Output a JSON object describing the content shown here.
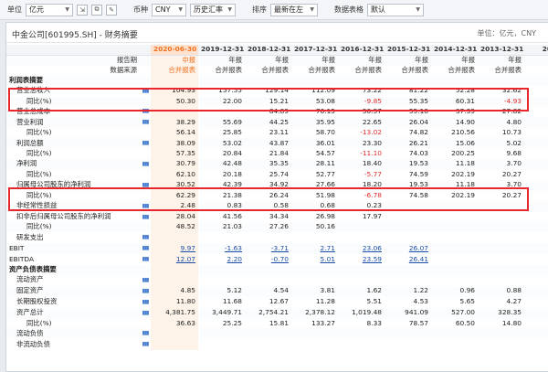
{
  "toolbar": {
    "unit_label": "单位",
    "unit_value": "亿元",
    "currency_label": "币种",
    "currency_value": "CNY",
    "rate_value": "历史汇率",
    "sort_label": "排序",
    "sort_value": "最新在左",
    "table_label": "数据表格",
    "table_value": "默认"
  },
  "header": {
    "company": "中金公司[601995.SH] - 财务摘要",
    "unit_note": "单位：亿元，CNY"
  },
  "table": {
    "dates": [
      "2020-06-30",
      "2019-12-31",
      "2018-12-31",
      "2017-12-31",
      "2016-12-31",
      "2015-12-31",
      "2014-12-31",
      "2013-12-31",
      "20"
    ],
    "period_label": "报告期",
    "periods": [
      "中报",
      "年报",
      "年报",
      "年报",
      "年报",
      "年报",
      "年报",
      "年报"
    ],
    "source_label": "数据来源",
    "sources": [
      "合并报表",
      "合并报表",
      "合并报表",
      "合并报表",
      "合并报表",
      "合并报表",
      "合并报表",
      "合并报表"
    ],
    "rows": [
      {
        "label": "利润表摘要",
        "type": "sec",
        "values": []
      },
      {
        "label": "营业总收入",
        "type": "l1",
        "chart": true,
        "values": [
          "104.93",
          "157.55",
          "129.14",
          "112.09",
          "73.22",
          "81.22",
          "52.28",
          "32.62"
        ]
      },
      {
        "label": "同比(%)",
        "type": "l2",
        "values": [
          "50.30",
          "22.00",
          "15.21",
          "53.08",
          "-9.85",
          "55.35",
          "60.31",
          "-4.93"
        ]
      },
      {
        "label": "营业总成本",
        "type": "l1",
        "chart": true,
        "values": [
          "",
          "",
          "84.89",
          "76.15",
          "50.57",
          "55.18",
          "37.39",
          "27.82"
        ]
      },
      {
        "label": "营业利润",
        "type": "l1",
        "chart": true,
        "values": [
          "38.29",
          "55.69",
          "44.25",
          "35.95",
          "22.65",
          "26.04",
          "14.90",
          "4.80"
        ]
      },
      {
        "label": "同比(%)",
        "type": "l2",
        "values": [
          "56.14",
          "25.85",
          "23.11",
          "58.70",
          "-13.02",
          "74.82",
          "210.56",
          "10.73"
        ]
      },
      {
        "label": "利润总额",
        "type": "l1",
        "chart": true,
        "values": [
          "38.09",
          "53.02",
          "43.87",
          "36.01",
          "23.30",
          "26.21",
          "15.06",
          "5.02"
        ]
      },
      {
        "label": "同比(%)",
        "type": "l2",
        "values": [
          "57.35",
          "20.84",
          "21.84",
          "54.57",
          "-11.10",
          "74.03",
          "200.25",
          "9.68"
        ]
      },
      {
        "label": "净利润",
        "type": "l1",
        "chart": true,
        "values": [
          "30.79",
          "42.48",
          "35.35",
          "28.11",
          "18.40",
          "19.53",
          "11.18",
          "3.70"
        ]
      },
      {
        "label": "同比(%)",
        "type": "l2",
        "values": [
          "62.10",
          "20.18",
          "25.74",
          "52.77",
          "-5.77",
          "74.59",
          "202.19",
          "20.27"
        ]
      },
      {
        "label": "归属母公司股东的净利润",
        "type": "l1",
        "chart": true,
        "values": [
          "30.52",
          "42.39",
          "34.92",
          "27.66",
          "18.20",
          "19.53",
          "11.18",
          "3.70"
        ]
      },
      {
        "label": "同比(%)",
        "type": "l2",
        "values": [
          "62.29",
          "21.38",
          "26.24",
          "51.98",
          "-6.78",
          "74.58",
          "202.19",
          "20.27"
        ]
      },
      {
        "label": "非经常性损益",
        "type": "l1",
        "chart": true,
        "values": [
          "2.48",
          "0.83",
          "0.58",
          "0.68",
          "0.23",
          "",
          "",
          ""
        ]
      },
      {
        "label": "扣非后归属母公司股东的净利润",
        "type": "l1",
        "chart": true,
        "values": [
          "28.04",
          "41.56",
          "34.34",
          "26.98",
          "17.97",
          "",
          "",
          ""
        ]
      },
      {
        "label": "同比(%)",
        "type": "l2",
        "values": [
          "48.52",
          "21.03",
          "27.26",
          "50.16",
          "",
          "",
          "",
          ""
        ]
      },
      {
        "label": "研发支出",
        "type": "l1",
        "chart": true,
        "values": [
          "",
          "",
          "",
          "",
          "",
          "",
          "",
          ""
        ]
      },
      {
        "label": "EBIT",
        "type": "l0",
        "chart": true,
        "link": true,
        "values": [
          "9.97",
          "-1.63",
          "-3.71",
          "2.71",
          "23.06",
          "26.07",
          "",
          ""
        ]
      },
      {
        "label": "EBITDA",
        "type": "l0",
        "chart": true,
        "link": true,
        "values": [
          "12.07",
          "2.20",
          "-0.70",
          "5.01",
          "23.59",
          "26.41",
          "",
          ""
        ]
      },
      {
        "label": "资产负债表摘要",
        "type": "sec",
        "values": []
      },
      {
        "label": "流动资产",
        "type": "l1",
        "chart": true,
        "values": [
          "",
          "",
          "",
          "",
          "",
          "",
          "",
          ""
        ]
      },
      {
        "label": "固定资产",
        "type": "l1",
        "chart": true,
        "values": [
          "4.85",
          "5.12",
          "4.54",
          "3.81",
          "1.62",
          "1.22",
          "0.96",
          "0.88"
        ]
      },
      {
        "label": "长期股权投资",
        "type": "l1",
        "chart": true,
        "values": [
          "11.80",
          "11.68",
          "12.67",
          "11.28",
          "5.51",
          "4.53",
          "5.65",
          "4.27"
        ]
      },
      {
        "label": "资产总计",
        "type": "l1",
        "chart": true,
        "values": [
          "4,381.75",
          "3,449.71",
          "2,754.21",
          "2,378.12",
          "1,019.48",
          "941.09",
          "527.00",
          "328.35"
        ]
      },
      {
        "label": "同比(%)",
        "type": "l2",
        "values": [
          "36.63",
          "25.25",
          "15.81",
          "133.27",
          "8.33",
          "78.57",
          "60.50",
          "14.80"
        ]
      },
      {
        "label": "流动负债",
        "type": "l1",
        "chart": true,
        "values": [
          "",
          "",
          "",
          "",
          "",
          "",
          "",
          ""
        ]
      },
      {
        "label": "非流动负债",
        "type": "l1",
        "chart": true,
        "values": [
          "",
          "",
          "",
          "",
          "",
          "",
          "",
          ""
        ]
      }
    ]
  },
  "icons": {
    "chart": "bar-chart-icon",
    "dropdown": "chevron-down-icon"
  },
  "colors": {
    "highlight_col": "#fde3cf",
    "negative": "#e02a2a",
    "link": "#1a4ea8",
    "annotation_box": "#e8262b"
  }
}
